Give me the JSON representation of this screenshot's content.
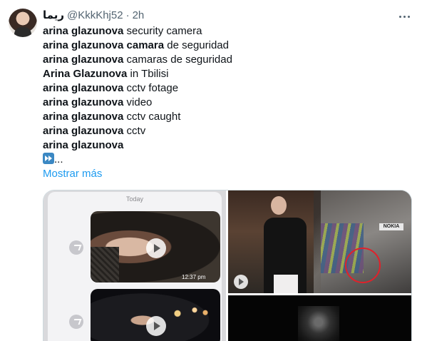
{
  "author": {
    "display_name": "ريما",
    "handle": "@KkkKhj52",
    "separator": "·",
    "time": "2h"
  },
  "tweet": {
    "lines": [
      {
        "bold": "arina glazunova",
        "rest": " security camera"
      },
      {
        "bold": "arina glazunova camara",
        "rest": " de seguridad"
      },
      {
        "bold": "arina glazunova",
        "rest": " camaras de seguridad"
      },
      {
        "bold": "Arina Glazunova",
        "rest": " in Tbilisi"
      },
      {
        "bold": "arina glazunova",
        "rest": " cctv fotage"
      },
      {
        "bold": "arina glazunova",
        "rest": " video"
      },
      {
        "bold": "arina glazunova",
        "rest": " cctv caught"
      },
      {
        "bold": "arina glazunova",
        "rest": " cctv"
      },
      {
        "bold": "arina glazunova",
        "rest": ""
      }
    ],
    "emoji_suffix": "...",
    "show_more": "Mostrar más"
  },
  "media": {
    "screenshot_header": "Today",
    "video_timestamp": "12:37 pm",
    "sign_text": "NOKIA"
  },
  "icons": {
    "more": "more-horizontal-icon",
    "fast_forward": "fast-forward-emoji-icon",
    "play": "play-icon",
    "forward": "share-forward-icon"
  },
  "colors": {
    "text_primary": "#0f1419",
    "text_secondary": "#536471",
    "link": "#1d9bf0",
    "highlight_circle": "#e1212a"
  }
}
